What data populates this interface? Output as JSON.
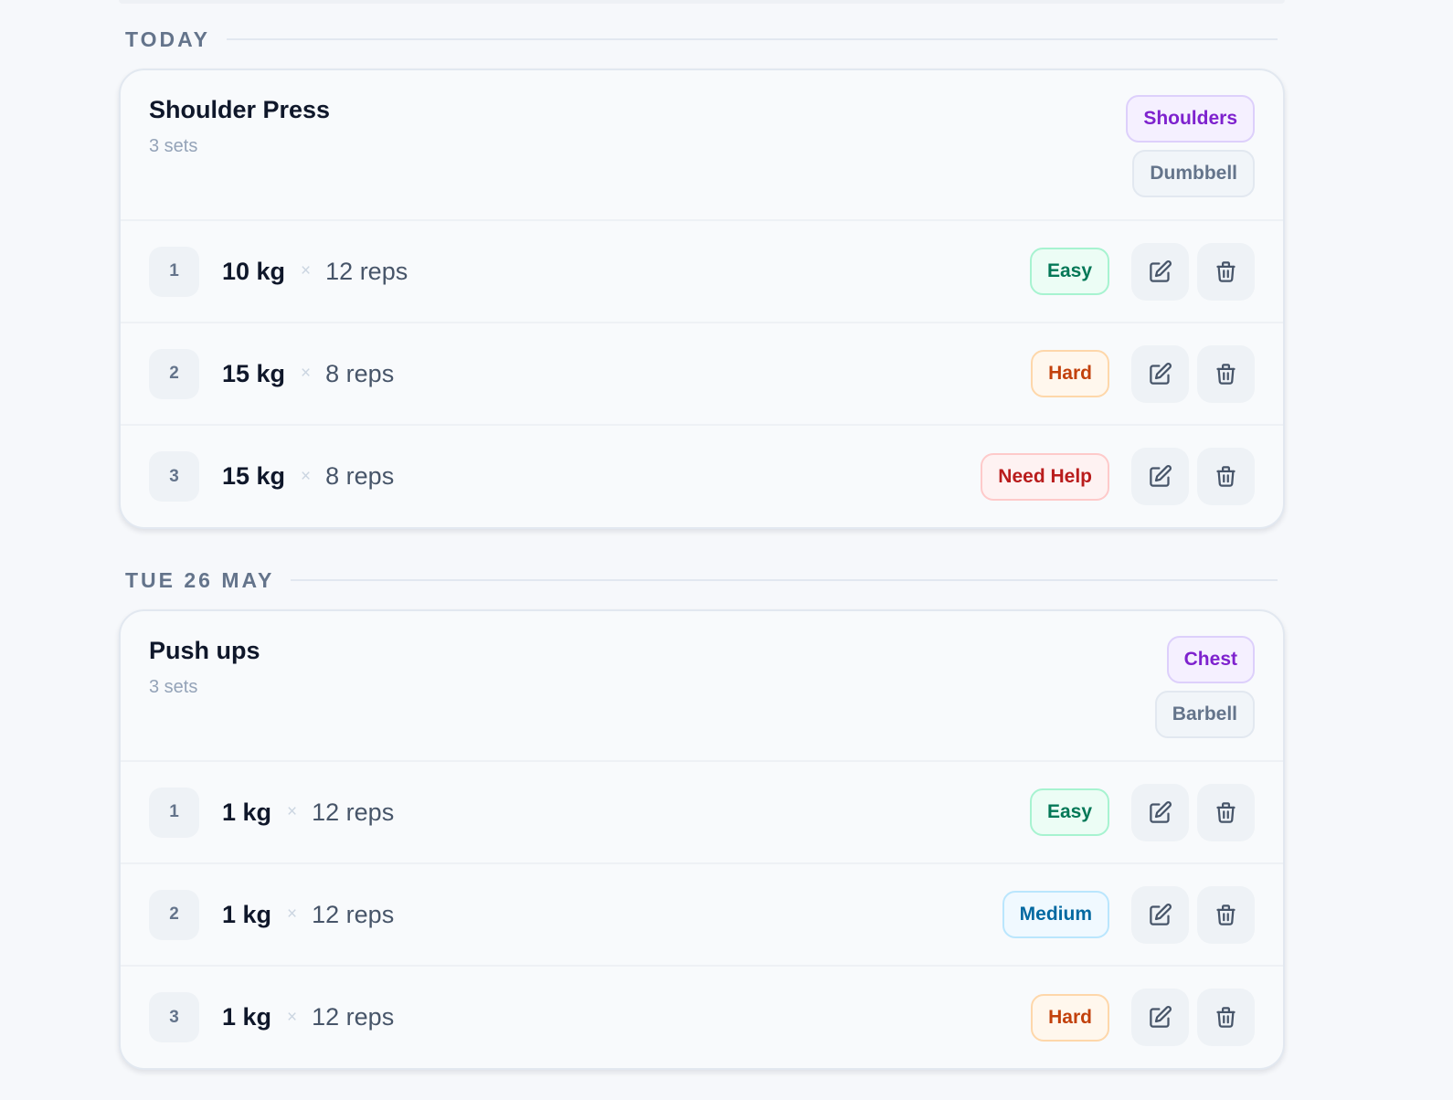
{
  "days": [
    {
      "label": "TODAY",
      "exercise": {
        "title": "Shoulder Press",
        "set_count": "3 sets",
        "muscle_tag": "Shoulders",
        "equipment_tag": "Dumbbell",
        "sets": [
          {
            "number": "1",
            "weight": "10 kg",
            "times": "×",
            "reps": "12 reps",
            "difficulty": "Easy",
            "level": "easy"
          },
          {
            "number": "2",
            "weight": "15 kg",
            "times": "×",
            "reps": "8 reps",
            "difficulty": "Hard",
            "level": "hard"
          },
          {
            "number": "3",
            "weight": "15 kg",
            "times": "×",
            "reps": "8 reps",
            "difficulty": "Need Help",
            "level": "help"
          }
        ]
      }
    },
    {
      "label": "TUE 26 MAY",
      "exercise": {
        "title": "Push ups",
        "set_count": "3 sets",
        "muscle_tag": "Chest",
        "equipment_tag": "Barbell",
        "sets": [
          {
            "number": "1",
            "weight": "1 kg",
            "times": "×",
            "reps": "12 reps",
            "difficulty": "Easy",
            "level": "easy"
          },
          {
            "number": "2",
            "weight": "1 kg",
            "times": "×",
            "reps": "12 reps",
            "difficulty": "Medium",
            "level": "medium"
          },
          {
            "number": "3",
            "weight": "1 kg",
            "times": "×",
            "reps": "12 reps",
            "difficulty": "Hard",
            "level": "hard"
          }
        ]
      }
    }
  ],
  "icons": {
    "edit": "edit-icon",
    "delete": "trash-icon"
  },
  "colors": {
    "easy": "#047857",
    "medium": "#0369a1",
    "hard": "#c2410c",
    "need_help": "#b91c1c",
    "muscle_tag": "#7e22ce",
    "equipment_tag": "#64748b"
  }
}
